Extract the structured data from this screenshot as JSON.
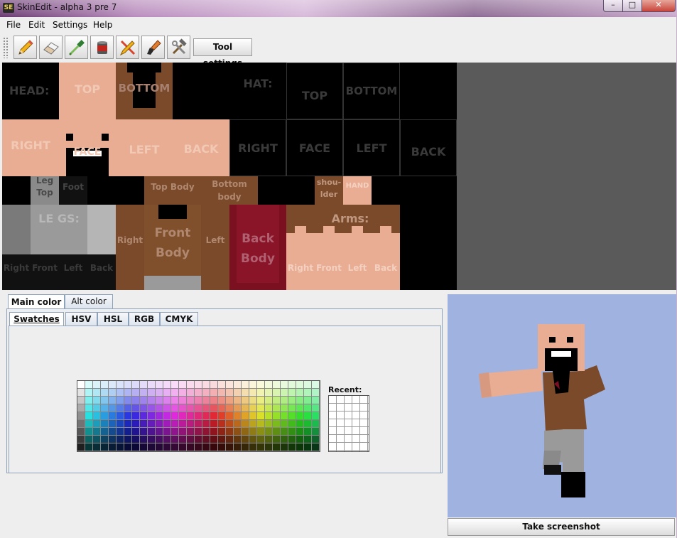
{
  "window": {
    "title": "SkinEdit - alpha 3 pre 7",
    "icon_text": "SE",
    "controls": [
      "–",
      "□",
      "✕"
    ]
  },
  "menu": [
    "File",
    "Edit",
    "Settings",
    "Help"
  ],
  "toolbar": {
    "tools": [
      "pencil-icon",
      "eraser-icon",
      "eyedropper-icon",
      "paint-bucket-icon",
      "pencil-cross-icon",
      "brush-icon",
      "hammer-wrench-icon"
    ],
    "settings_label": "Tool settings"
  },
  "skin": {
    "head_label": "HEAD:",
    "hat_label": "HAT:",
    "head": {
      "top": "TOP",
      "bottom": "BOTTOM",
      "right": "RIGHT",
      "face": "FACE",
      "left": "LEFT",
      "back": "BACK"
    },
    "hat": {
      "top": "TOP",
      "bottom": "BOTTOM",
      "right": "RIGHT",
      "face": "FACE",
      "left": "LEFT",
      "back": "BACK"
    },
    "legs": {
      "leg_top": "Leg\nTop",
      "foot": "Foot",
      "label": "LE GS:",
      "right": "Right",
      "front": "Front",
      "left": "Left",
      "back": "Back"
    },
    "body": {
      "top": "Top Body",
      "bottom": "Bottom\nbody",
      "right": "Right",
      "front": "Front\nBody",
      "left": "Left",
      "back": "Back\nBody"
    },
    "arms": {
      "shoulder": "shou-\nlder",
      "hand": "HAND",
      "label": "Arms:",
      "right": "Right",
      "front": "Front",
      "left": "Left",
      "back": "Back"
    }
  },
  "color_tabs": [
    "Main color",
    "Alt color"
  ],
  "color_subtabs": [
    "Swatches",
    "HSV",
    "HSL",
    "RGB",
    "CMYK"
  ],
  "recent_label": "Recent:",
  "screenshot_button": "Take screenshot",
  "colors": {
    "skin": "#e8ad93",
    "skin_dark": "#c48b76",
    "brown": "#7a4a2a",
    "dark_red": "#7a1020",
    "gray": "#9a9a9a",
    "preview_bg": "#9fb2e0"
  }
}
